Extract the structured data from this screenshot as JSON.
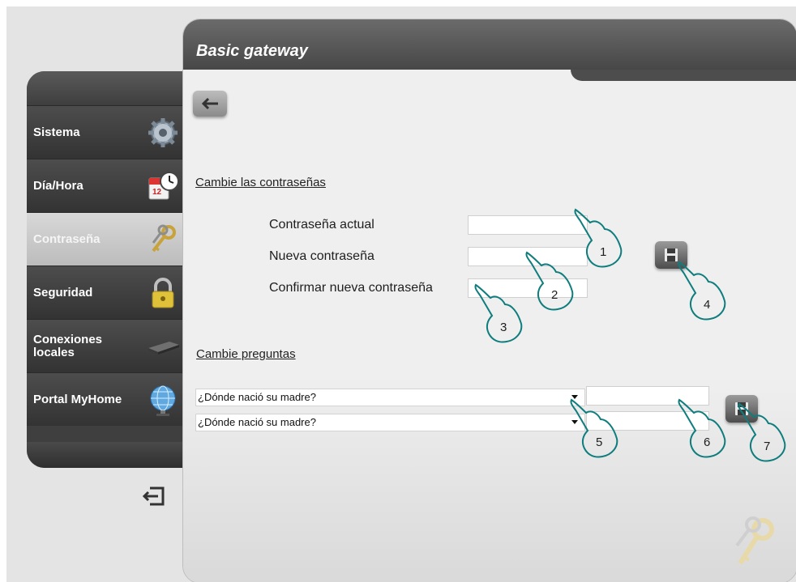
{
  "header": {
    "title": "Basic gateway"
  },
  "sidebar": {
    "items": [
      {
        "label": "Sistema",
        "icon": "gear-icon"
      },
      {
        "label": "Día/Hora",
        "icon": "calendar-clock-icon"
      },
      {
        "label": "Contraseña",
        "icon": "keys-icon",
        "active": true
      },
      {
        "label": "Seguridad",
        "icon": "padlock-icon"
      },
      {
        "label": "Conexiones locales",
        "icon": "router-icon"
      },
      {
        "label": "Portal MyHome",
        "icon": "globe-icon"
      }
    ]
  },
  "passwords": {
    "section_title": "Cambie las contraseñas",
    "current_label": "Contraseña actual",
    "new_label": "Nueva contraseña",
    "confirm_label": "Confirmar nueva contraseña",
    "current_value": "",
    "new_value": "",
    "confirm_value": ""
  },
  "questions": {
    "section_title": "Cambie preguntas",
    "question1": "¿Dónde nació su madre?",
    "question2": "¿Dónde nació su madre?",
    "answer1": "",
    "answer2": ""
  },
  "callouts": [
    "1",
    "2",
    "3",
    "4",
    "5",
    "6",
    "7"
  ],
  "colors": {
    "header": "#4f4f4f",
    "sidebar": "#3f3f3f",
    "active_item": "#c9c9c9",
    "panel": "#ebebeb"
  }
}
